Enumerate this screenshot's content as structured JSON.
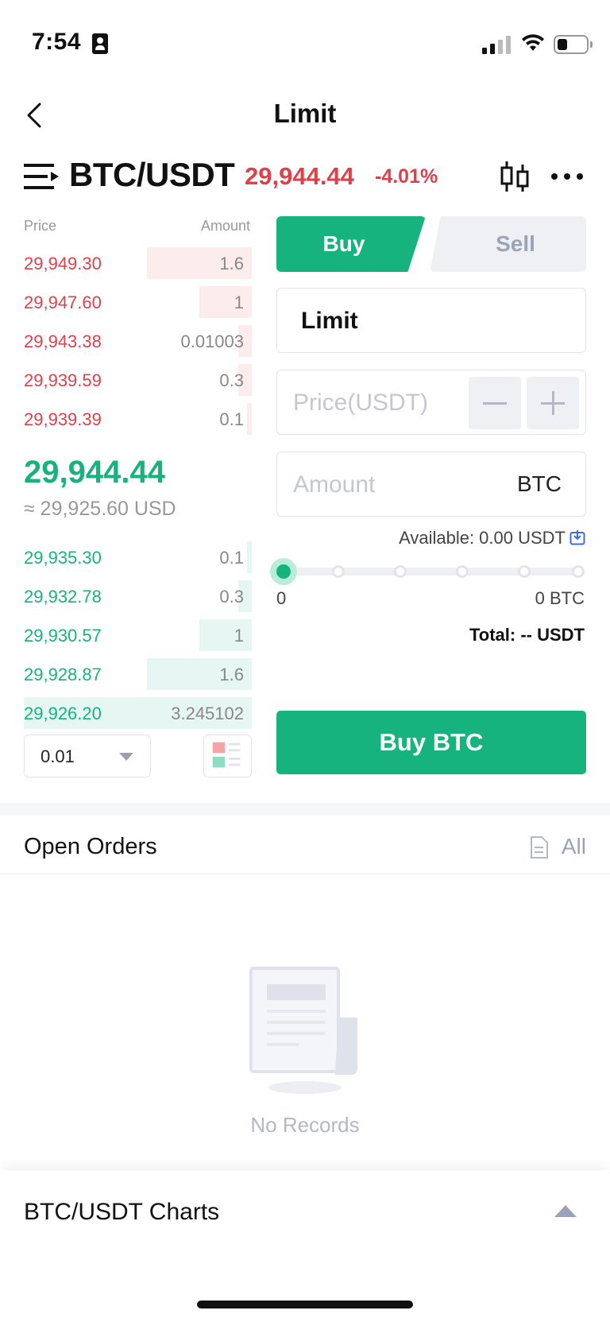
{
  "status": {
    "time": "7:54"
  },
  "nav": {
    "title": "Limit"
  },
  "pair": {
    "name": "BTC/USDT",
    "price": "29,944.44",
    "change": "-4.01%"
  },
  "orderbook": {
    "price_header": "Price",
    "amount_header": "Amount",
    "asks": [
      {
        "price": "29,949.30",
        "amount": "1.6",
        "depth": 0.46
      },
      {
        "price": "29,947.60",
        "amount": "1",
        "depth": 0.23
      },
      {
        "price": "29,943.38",
        "amount": "0.01003",
        "depth": 0.06
      },
      {
        "price": "29,939.59",
        "amount": "0.3",
        "depth": 0.06
      },
      {
        "price": "29,939.39",
        "amount": "0.1",
        "depth": 0.02
      }
    ],
    "mid_price": "29,944.44",
    "mid_usd": "≈ 29,925.60 USD",
    "bids": [
      {
        "price": "29,935.30",
        "amount": "0.1",
        "depth": 0.02
      },
      {
        "price": "29,932.78",
        "amount": "0.3",
        "depth": 0.06
      },
      {
        "price": "29,930.57",
        "amount": "1",
        "depth": 0.23
      },
      {
        "price": "29,928.87",
        "amount": "1.6",
        "depth": 0.46
      },
      {
        "price": "29,926.20",
        "amount": "3.245102",
        "depth": 1.0
      }
    ],
    "precision": "0.01"
  },
  "form": {
    "tab_buy": "Buy",
    "tab_sell": "Sell",
    "order_type": "Limit",
    "price_placeholder": "Price(USDT)",
    "amount_placeholder": "Amount",
    "amount_unit": "BTC",
    "available": "Available: 0.00 USDT",
    "slider_min": "0",
    "slider_max": "0 BTC",
    "total": "Total: -- USDT",
    "submit": "Buy BTC"
  },
  "orders": {
    "title": "Open Orders",
    "all_label": "All",
    "empty": "No Records"
  },
  "charts": {
    "label": "BTC/USDT Charts"
  },
  "colors": {
    "buy": "#17b37e",
    "sell": "#e0404a",
    "muted": "#9aa3b7"
  },
  "icons": [
    "back-icon",
    "menu-icon",
    "candlestick-icon",
    "more-icon",
    "transfer-icon",
    "document-icon",
    "chevron-up-icon",
    "chevron-down-icon"
  ]
}
